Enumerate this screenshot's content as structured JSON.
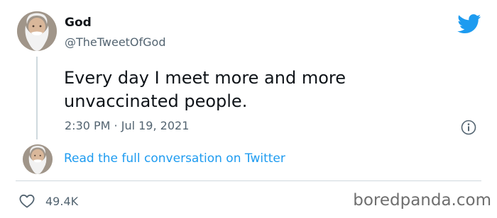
{
  "tweet": {
    "display_name": "God",
    "handle": "@TheTweetOfGod",
    "text": "Every day I meet more and more unvaccinated people.",
    "timestamp": "2:30 PM · Jul 19, 2021"
  },
  "conversation": {
    "link_text": "Read the full conversation on Twitter"
  },
  "actions": {
    "like_count": "49.4K"
  },
  "watermark": {
    "text": "boredpanda.com"
  },
  "icons": {
    "brand": "twitter-bird-icon",
    "info": "info-icon",
    "like": "heart-icon"
  },
  "colors": {
    "accent": "#1d9bf0",
    "text": "#0f1419",
    "secondary": "#536471",
    "divider": "#cfd9de"
  }
}
